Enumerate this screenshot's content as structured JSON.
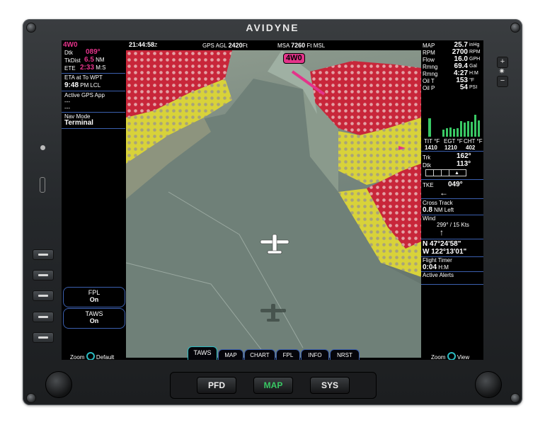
{
  "brand": "AVIDYNE",
  "top": {
    "time": "21:44:58",
    "time_unit": "Z",
    "agl_label": "GPS AGL",
    "agl_value": "2420",
    "agl_unit": "Ft",
    "msa_label": "MSA",
    "msa_value": "7260",
    "msa_unit": "Ft MSL"
  },
  "left": {
    "waypoint": "4W0",
    "dtk_label": "Dtk",
    "dtk_value": "089°",
    "tkdist_label": "TkDist",
    "tkdist_value": "6.5",
    "tkdist_unit": "NM",
    "ete_label": "ETE",
    "ete_value": "2:33",
    "ete_unit": "M:S",
    "eta_label": "ETA at To WPT",
    "eta_value": "9:48",
    "eta_unit": "PM LCL",
    "gps_app_label": "Active GPS App",
    "gps_app_line1": "---",
    "gps_app_line2": "---",
    "nav_mode_label": "Nav Mode",
    "nav_mode_value": "Terminal",
    "fpl_label": "FPL",
    "fpl_value": "On",
    "taws_label": "TAWS",
    "taws_value": "On",
    "zoom_label": "Zoom",
    "zoom_value": "Default"
  },
  "view": {
    "waypoint_tag": "4W0"
  },
  "right": {
    "engine": [
      {
        "label": "MAP",
        "value": "25.7",
        "unit": "inHg"
      },
      {
        "label": "RPM",
        "value": "2700",
        "unit": "RPM"
      },
      {
        "label": "Flow",
        "value": "16.0",
        "unit": "GPH"
      },
      {
        "label": "Rmng",
        "value": "69.4",
        "unit": "Gal"
      },
      {
        "label": "Rmng",
        "value": "4:27",
        "unit": "H:M"
      },
      {
        "label": "Oil T",
        "value": "153",
        "unit": "°F"
      },
      {
        "label": "Oil P",
        "value": "54",
        "unit": "PSI"
      }
    ],
    "temps": {
      "tit_label": "TIT °F",
      "tit_value": "1410",
      "egt_label": "EGT °F",
      "egt_value": "1210",
      "cht_label": "CHT °F",
      "cht_value": "402"
    },
    "egt_bars": [
      0.28,
      0.32,
      0.35,
      0.3,
      0.33,
      0.29
    ],
    "cht_bars": [
      0.6,
      0.55,
      0.62,
      0.58,
      0.85,
      0.65
    ],
    "trk_label": "Trk",
    "trk_value": "162°",
    "dtk_label": "Dtk",
    "dtk_value": "113°",
    "tke_label": "TKE",
    "tke_value": "049°",
    "xtrack_label": "Cross Track",
    "xtrack_value": "0.8",
    "xtrack_unit": "NM Left",
    "wind_label": "Wind",
    "wind_value": "299° / 15",
    "wind_unit": "Kts",
    "lat": "N 47°24'58\"",
    "lon": "W 122°13'01\"",
    "timer_label": "Flight Timer",
    "timer_value": "0:04",
    "timer_unit": "H:M",
    "alerts_label": "Active Alerts",
    "zoom_label": "Zoom",
    "zoom_value": "View"
  },
  "tabs": [
    "TAWS",
    "MAP",
    "CHART",
    "FPL",
    "INFO",
    "NRST"
  ],
  "hard_buttons": [
    "PFD",
    "MAP",
    "SYS"
  ],
  "colors": {
    "magenta": "#e4338a",
    "cyan": "#2bbcc2",
    "border": "#3b5fae",
    "green": "#39c864"
  }
}
